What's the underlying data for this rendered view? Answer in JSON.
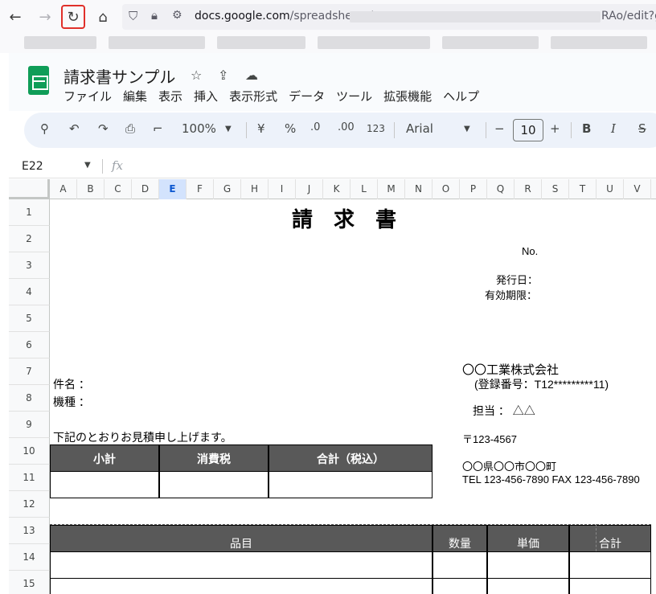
{
  "browser": {
    "url_host": "docs.google.com",
    "url_path": "/spreadsheets/",
    "url_end": "RAo/edit?g"
  },
  "doc": {
    "title": "請求書サンプル"
  },
  "menu": [
    "ファイル",
    "編集",
    "表示",
    "挿入",
    "表示形式",
    "データ",
    "ツール",
    "拡張機能",
    "ヘルプ"
  ],
  "toolbar": {
    "zoom": "100%",
    "currency": "¥",
    "percent": "%",
    "dec_decrease": ".0",
    "dec_increase": ".00",
    "number_format": "123",
    "font": "Arial",
    "font_size": "10",
    "minus": "−",
    "plus": "+",
    "bold": "B",
    "italic": "I",
    "strike": "S"
  },
  "formula": {
    "cell_ref": "E22",
    "fx": "fx"
  },
  "columns": [
    "A",
    "B",
    "C",
    "D",
    "E",
    "F",
    "G",
    "H",
    "I",
    "J",
    "K",
    "L",
    "M",
    "N",
    "O",
    "P",
    "Q",
    "R",
    "S",
    "T",
    "U",
    "V"
  ],
  "selected_column": "E",
  "rows": [
    "1",
    "2",
    "3",
    "4",
    "5",
    "6",
    "7",
    "8",
    "9",
    "10",
    "11",
    "12",
    "13",
    "14",
    "15"
  ],
  "invoice": {
    "heading": "請　求　書",
    "no_label": "No.",
    "issue_date_label": "発行日：",
    "due_date_label": "有効期限：",
    "subject_label": "件名 ：",
    "model_label": "機種 ：",
    "company": "〇〇工業株式会社",
    "registration": "(登録番号：T12*********11)",
    "person": "担当 ：  △△",
    "intro": "下記のとおりお見積申し上げます。",
    "postal": "〒123-4567",
    "address": "〇〇県〇〇市〇〇町",
    "phone": "TEL 123-456-7890  FAX 123-456-7890",
    "summary_headers": [
      "小計",
      "消費税",
      "合計（税込）"
    ],
    "item_headers": [
      "品目",
      "数量",
      "単価",
      "合計"
    ]
  },
  "colors": {
    "header_fill": "#595959",
    "selected_col": "#d3e3fd",
    "reload_highlight": "#e0302a"
  }
}
